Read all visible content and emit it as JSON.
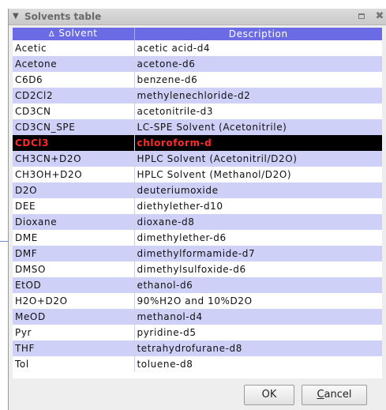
{
  "window": {
    "title": "Solvents table",
    "collapse_glyph": "▼",
    "restore_glyph": "restore",
    "close_glyph": "✖"
  },
  "table": {
    "sort_arrow": "Δ",
    "columns": [
      "Solvent",
      "Description"
    ],
    "rows": [
      {
        "solvent": "Acetic",
        "description": "acetic acid-d4"
      },
      {
        "solvent": "Acetone",
        "description": "acetone-d6"
      },
      {
        "solvent": "C6D6",
        "description": "benzene-d6"
      },
      {
        "solvent": "CD2Cl2",
        "description": "methylenechloride-d2"
      },
      {
        "solvent": "CD3CN",
        "description": "acetonitrile-d3"
      },
      {
        "solvent": "CD3CN_SPE",
        "description": "LC-SPE Solvent (Acetonitrile)"
      },
      {
        "solvent": "CDCl3",
        "description": "chloroform-d",
        "selected": true
      },
      {
        "solvent": "CH3CN+D2O",
        "description": "HPLC Solvent (Acetonitril/D2O)"
      },
      {
        "solvent": "CH3OH+D2O",
        "description": "HPLC Solvent (Methanol/D2O)"
      },
      {
        "solvent": "D2O",
        "description": "deuteriumoxide"
      },
      {
        "solvent": "DEE",
        "description": "diethylether-d10"
      },
      {
        "solvent": "Dioxane",
        "description": "dioxane-d8"
      },
      {
        "solvent": "DME",
        "description": "dimethylether-d6"
      },
      {
        "solvent": "DMF",
        "description": "dimethylformamide-d7"
      },
      {
        "solvent": "DMSO",
        "description": "dimethylsulfoxide-d6"
      },
      {
        "solvent": "EtOD",
        "description": "ethanol-d6"
      },
      {
        "solvent": "H2O+D2O",
        "description": "90%H2O and 10%D2O"
      },
      {
        "solvent": "MeOD",
        "description": "methanol-d4"
      },
      {
        "solvent": "Pyr",
        "description": "pyridine-d5"
      },
      {
        "solvent": "THF",
        "description": "tetrahydrofurane-d8"
      },
      {
        "solvent": "Tol",
        "description": "toluene-d8"
      }
    ]
  },
  "buttons": {
    "ok_label": "OK",
    "cancel_mnemonic": "C",
    "cancel_rest": "ancel"
  },
  "colors": {
    "header_bg": "#6b6be6",
    "row_alt_bg": "#cfd0f7",
    "selected_bg": "#000000",
    "selected_fg": "#ff2a2a"
  }
}
